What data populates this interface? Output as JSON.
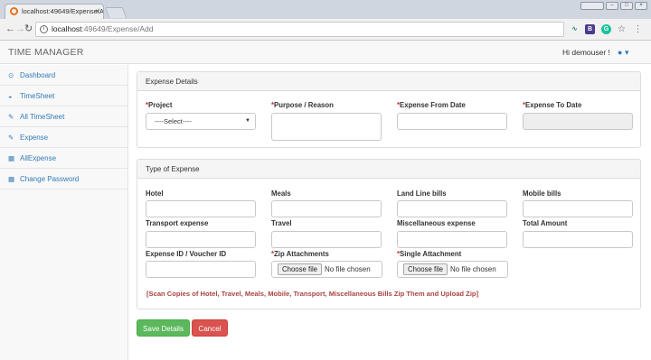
{
  "browser": {
    "tab_title": "localhost:49649/Expense/A",
    "tab_close": "×",
    "url_host": "localhost",
    "url_path": ":49649/Expense/Add",
    "back_glyph": "←",
    "forward_glyph": "→",
    "reload_glyph": "↻",
    "star_glyph": "☆",
    "menu_glyph": "⋮",
    "extensions": [
      {
        "icon": "extension-wave-icon",
        "glyph": "∿",
        "color": "#1e8c5a"
      },
      {
        "icon": "extension-b-icon",
        "glyph": "B",
        "color": "#4b3a8c"
      },
      {
        "icon": "extension-grammarly-icon",
        "glyph": "G",
        "color": "#15c39a"
      }
    ]
  },
  "app": {
    "brand": "TIME MANAGER",
    "user_greeting": "Hi demouser !",
    "user_icon": "user-icon",
    "user_caret": "▾"
  },
  "sidebar": {
    "items": [
      {
        "label": "Dashboard",
        "icon": "dashboard-icon",
        "glyph": "⊙"
      },
      {
        "label": "TimeSheet",
        "icon": "tachometer-icon",
        "glyph": "◒"
      },
      {
        "label": "All TimeSheet",
        "icon": "edit-icon",
        "glyph": "✎"
      },
      {
        "label": "Expense",
        "icon": "edit-icon",
        "glyph": "✎"
      },
      {
        "label": "AllExpense",
        "icon": "table-icon",
        "glyph": "▦"
      },
      {
        "label": "Change Password",
        "icon": "table-icon",
        "glyph": "▦"
      }
    ]
  },
  "expense_details": {
    "heading": "Expense Details",
    "required_mark": "*",
    "project_label": "Project",
    "project_selected": "----Select----",
    "purpose_label": "Purpose / Reason",
    "from_date_label": "Expense From Date",
    "to_date_label": "Expense To Date"
  },
  "type_of_expense": {
    "heading": "Type of Expense",
    "required_mark": "*",
    "hotel_label": "Hotel",
    "meals_label": "Meals",
    "landline_label": "Land Line bills",
    "mobile_label": "Mobile bills",
    "transport_label": "Transport expense",
    "travel_label": "Travel",
    "misc_label": "Miscellaneous expense",
    "total_label": "Total Amount",
    "voucher_label": "Expense ID / Voucher ID",
    "zip_label": "Zip Attachments",
    "single_label": "Single Attachment",
    "choose_file": "Choose file",
    "no_file": "No file chosen",
    "note": "[Scan Copies of Hotel, Travel, Meals, Mobile, Transport, Miscellaneous Bills Zip Them and Upload Zip]"
  },
  "actions": {
    "save_label": "Save Details",
    "cancel_label": "Cancel"
  }
}
